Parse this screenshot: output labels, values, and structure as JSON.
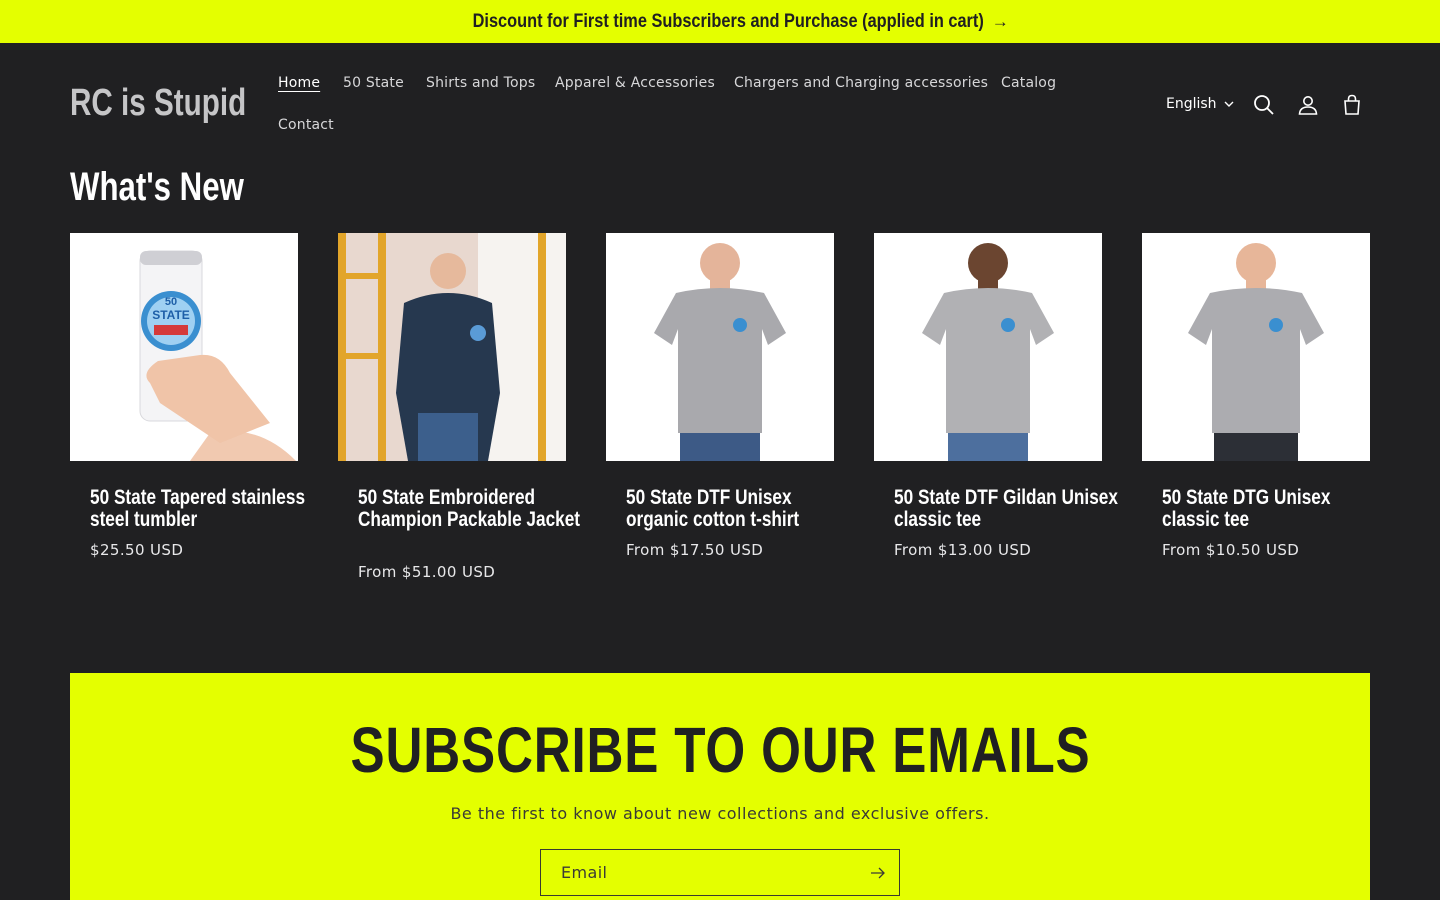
{
  "announcement": {
    "text": "Discount for First time Subscribers and Purchase (applied in cart)",
    "arrow": "→"
  },
  "header": {
    "logo": "RC is Stupid",
    "nav": [
      "Home",
      "50 State",
      "Shirts and Tops",
      "Apparel & Accessories",
      "Chargers and Charging accessories",
      "Catalog",
      "Contact"
    ],
    "active": "Home",
    "language": "English",
    "icons": [
      "search-icon",
      "account-icon",
      "cart-icon"
    ]
  },
  "section": {
    "title": "What's New"
  },
  "products": [
    {
      "title": "50 State Tapered stainless steel tumbler",
      "price": "$25.50 USD"
    },
    {
      "title": "50 State Embroidered Champion Packable Jacket",
      "price": "From $51.00 USD"
    },
    {
      "title": "50 State DTF Unisex organic cotton t-shirt",
      "price": "From $17.50 USD"
    },
    {
      "title": "50 State DTF Gildan Unisex classic tee",
      "price": "From $13.00 USD"
    },
    {
      "title": "50 State DTG Unisex classic tee",
      "price": "From $10.50 USD"
    }
  ],
  "subscribe": {
    "heading": "SUBSCRIBE TO OUR EMAILS",
    "text": "Be the first to know about new collections and exclusive offers.",
    "placeholder": "Email"
  },
  "colors": {
    "accent": "#e4ff00",
    "background": "#202022",
    "text": "#ffffff"
  }
}
